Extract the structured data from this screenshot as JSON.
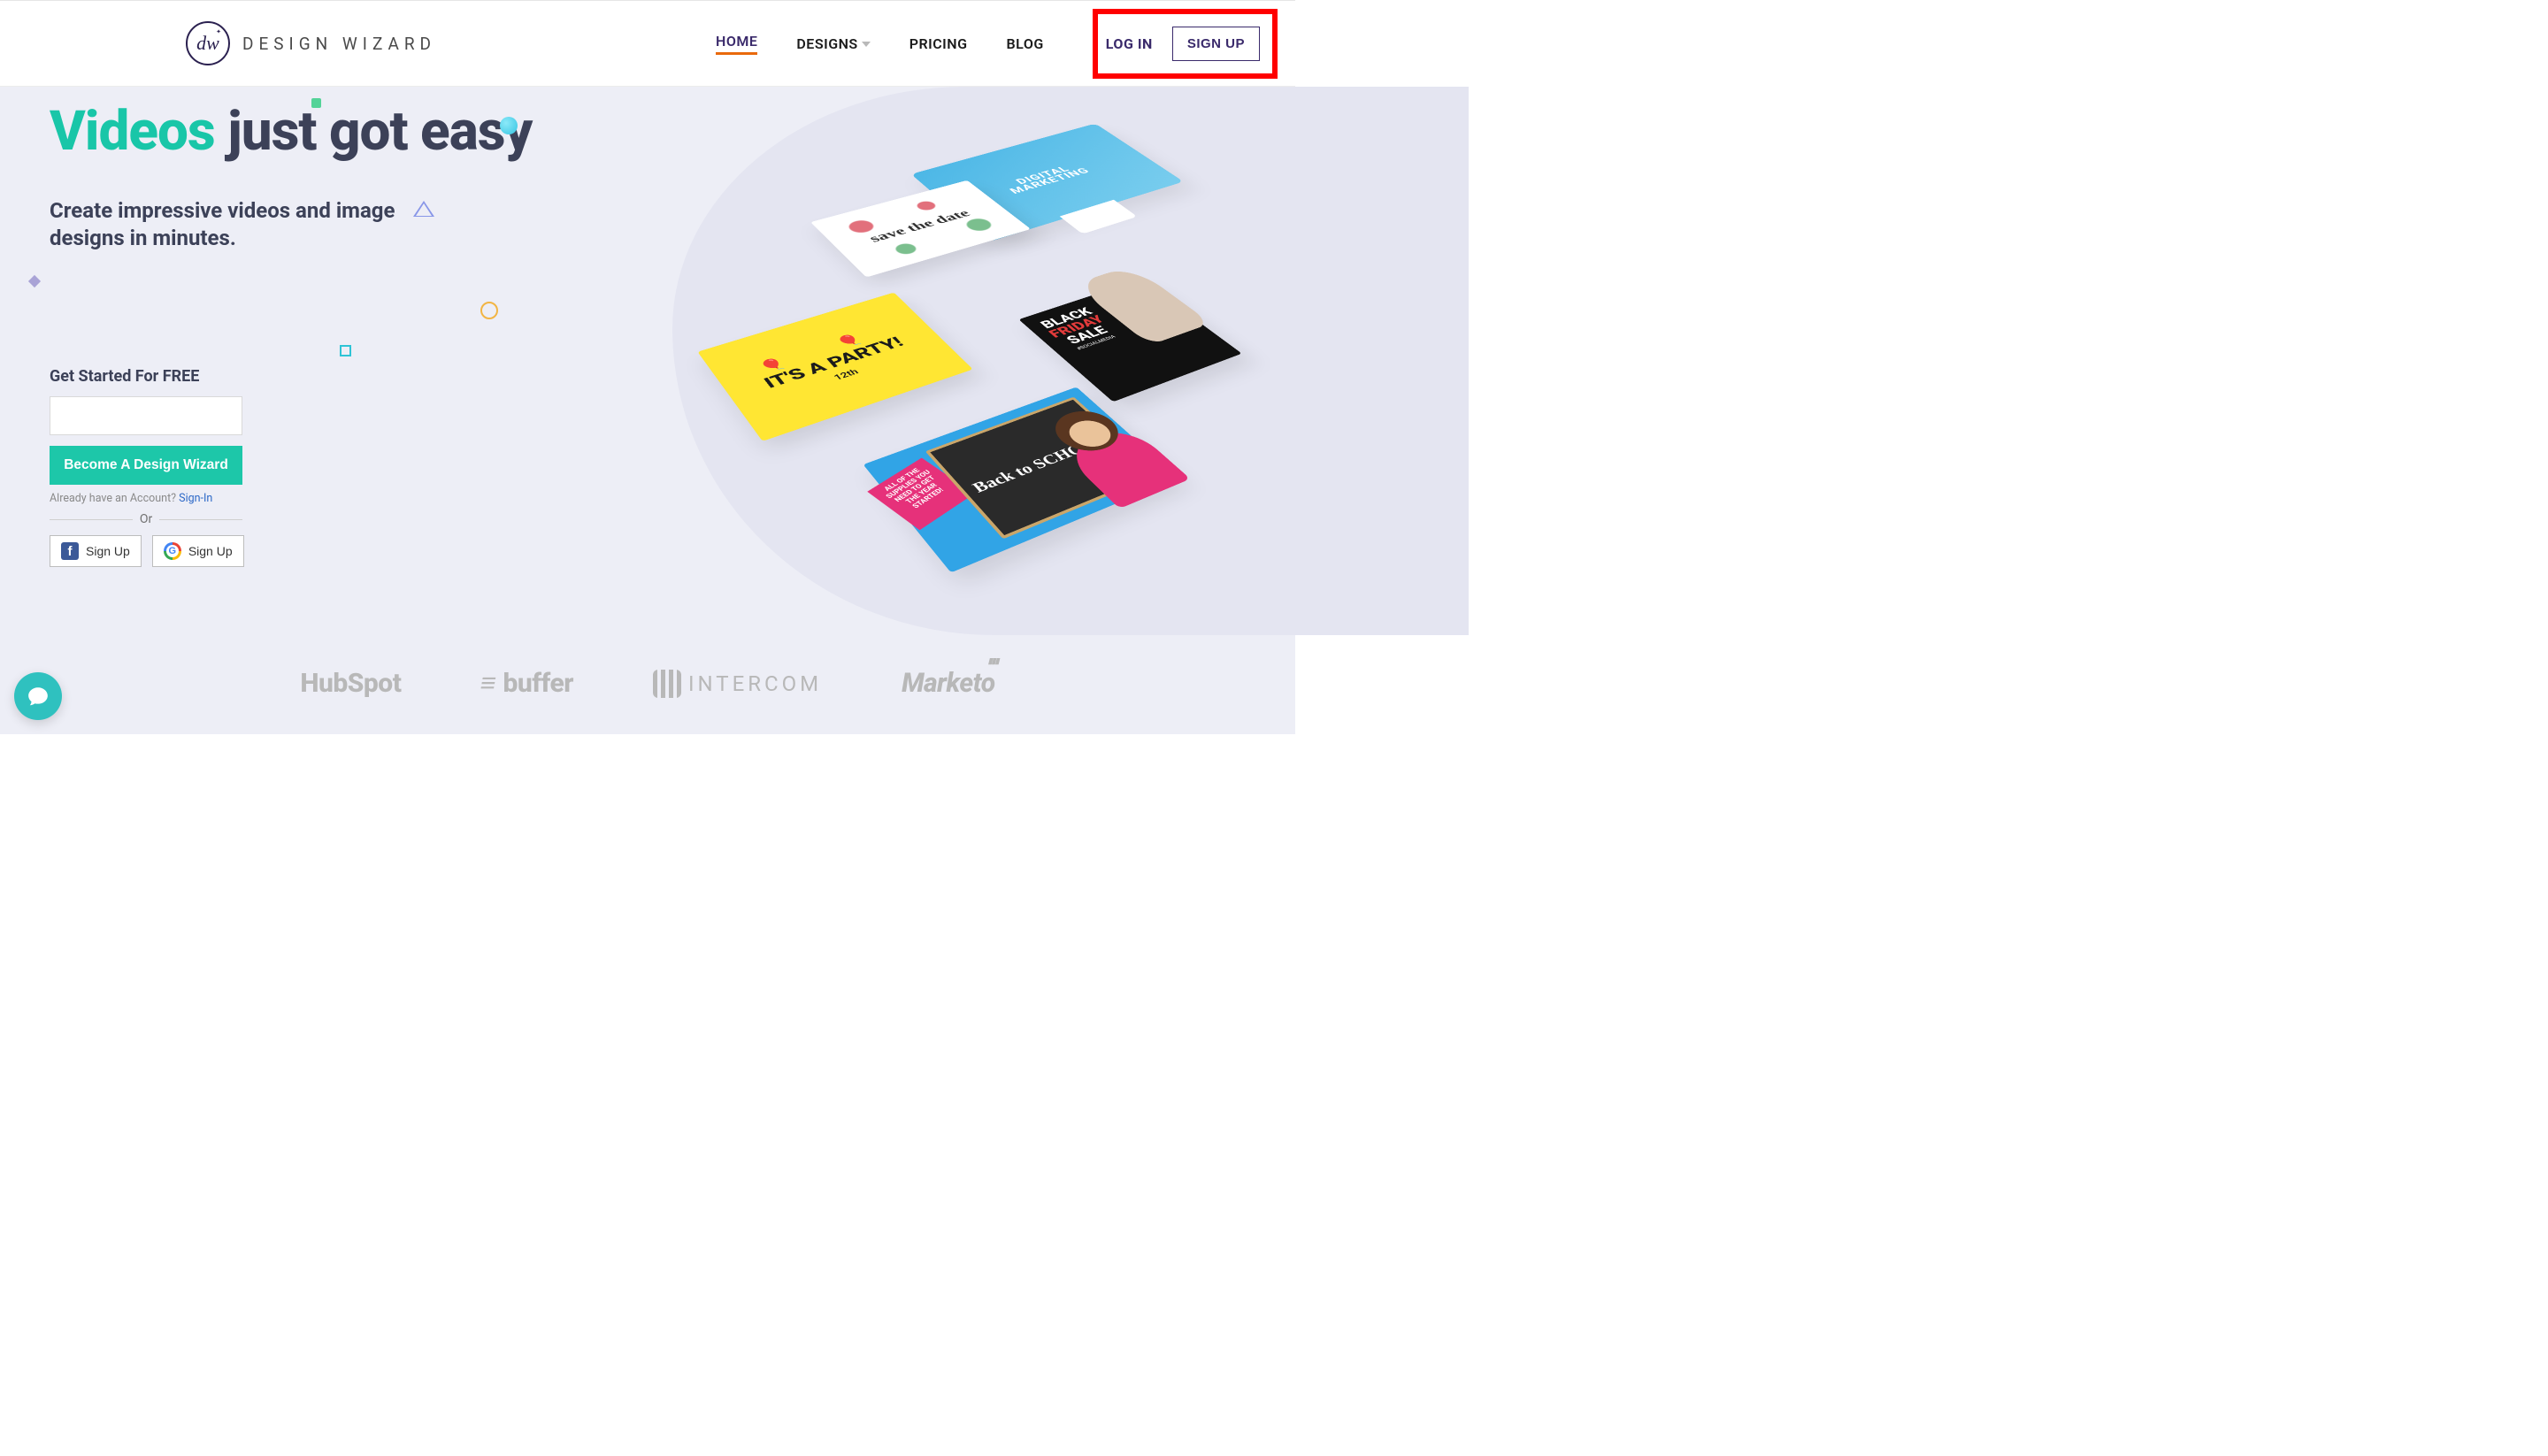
{
  "brand": {
    "logo_text": "dw",
    "name": "DESIGN WIZARD"
  },
  "nav": {
    "home": "HOME",
    "designs": "DESIGNS",
    "pricing": "PRICING",
    "blog": "BLOG",
    "login": "LOG IN",
    "signup": "SIGN UP"
  },
  "hero": {
    "headline_accent": "Videos",
    "headline_rest": "just got easy",
    "subhead": "Create impressive videos and image designs in minutes."
  },
  "signup": {
    "get_started": "Get Started For FREE",
    "cta": "Become A Design Wizard",
    "already_prefix": "Already have an Account? ",
    "signin": "Sign-In",
    "or": "Or",
    "fb_label": "Sign Up",
    "g_label": "Sign Up"
  },
  "illus": {
    "monitor_top": "DIGITAL",
    "monitor_bottom": "MARKETING",
    "save": "save the date",
    "party": "IT'S A PARTY!",
    "party_sub": "12th",
    "bf_line1": "BLACK",
    "bf_line2": "FRIDAY",
    "bf_line3": "SALE",
    "bf_tag": "#SOCIALMEDIA",
    "school_board": "Back to SCHOOL",
    "school_ribbon": "ALL OF THE SUPPLIES YOU NEED TO GET THE YEAR STARTED!"
  },
  "logos": {
    "hubspot": "HubSpot",
    "buffer": "buffer",
    "intercom": "INTERCOM",
    "marketo": "Marketo"
  }
}
